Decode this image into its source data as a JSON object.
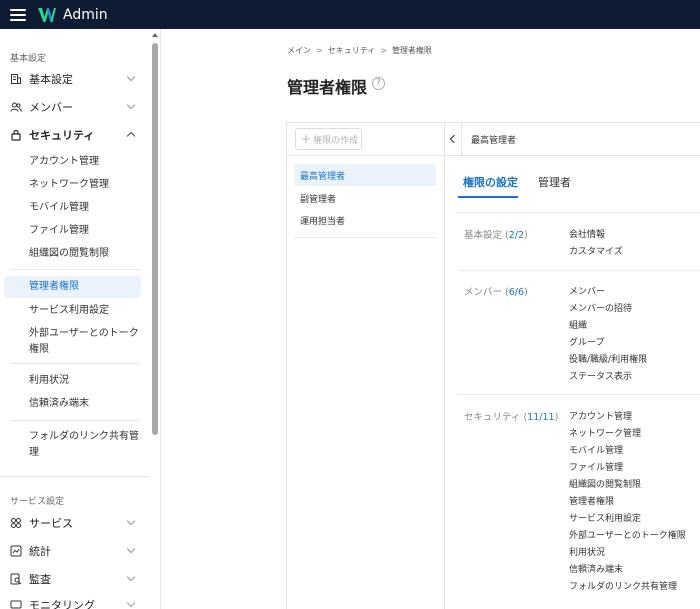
{
  "app": {
    "title": "Admin",
    "logo_icon": "w-logo-icon",
    "brand_color": "#0d1b33",
    "accent": "#1a73c9"
  },
  "sidebar": {
    "section1": "基本設定",
    "section2": "サービス設定",
    "menus": {
      "basic": "基本設定",
      "member": "メンバー",
      "security": "セキュリティ",
      "service": "サービス",
      "stats": "統計",
      "audit": "監査",
      "monitoring": "モニタリング"
    },
    "security_items": {
      "account": "アカウント管理",
      "network": "ネットワーク管理",
      "mobile": "モバイル管理",
      "file": "ファイル管理",
      "orgchart": "組織図の閲覧制限",
      "admin": "管理者権限",
      "service_use": "サービス利用設定",
      "external_1": "外部ユーザーとのトーク",
      "external_2": "権限",
      "usage": "利用状況",
      "trusted": "信頼済み端末",
      "folder_1": "フォルダのリンク共有管",
      "folder_2": "理"
    }
  },
  "breadcrumb": {
    "home": "メイン",
    "security": "セキュリティ",
    "current": "管理者権限",
    "sep": ">"
  },
  "page": {
    "title": "管理者権限",
    "help": "?"
  },
  "roles_panel": {
    "create_label": "権限の作成",
    "roles": [
      "最高管理者",
      "副管理者",
      "運用担当者"
    ]
  },
  "detail": {
    "title": "最高管理者",
    "tabs": [
      "権限の設定",
      "管理者"
    ],
    "groups": [
      {
        "label": "基本設定",
        "count": "2/2",
        "items": [
          "会社情報",
          "カスタマイズ"
        ]
      },
      {
        "label": "メンバー",
        "count": "6/6",
        "items": [
          "メンバー",
          "メンバーの招待",
          "組織",
          "グループ",
          "役職/職級/利用権限",
          "ステータス表示"
        ]
      },
      {
        "label": "セキュリティ",
        "count": "11/11",
        "items": [
          "アカウント管理",
          "ネットワーク管理",
          "モバイル管理",
          "ファイル管理",
          "組織図の閲覧制限",
          "管理者権限",
          "サービス利用設定",
          "外部ユーザーとのトーク権限",
          "利用状況",
          "信頼済み端末",
          "フォルダのリンク共有管理"
        ]
      }
    ]
  }
}
